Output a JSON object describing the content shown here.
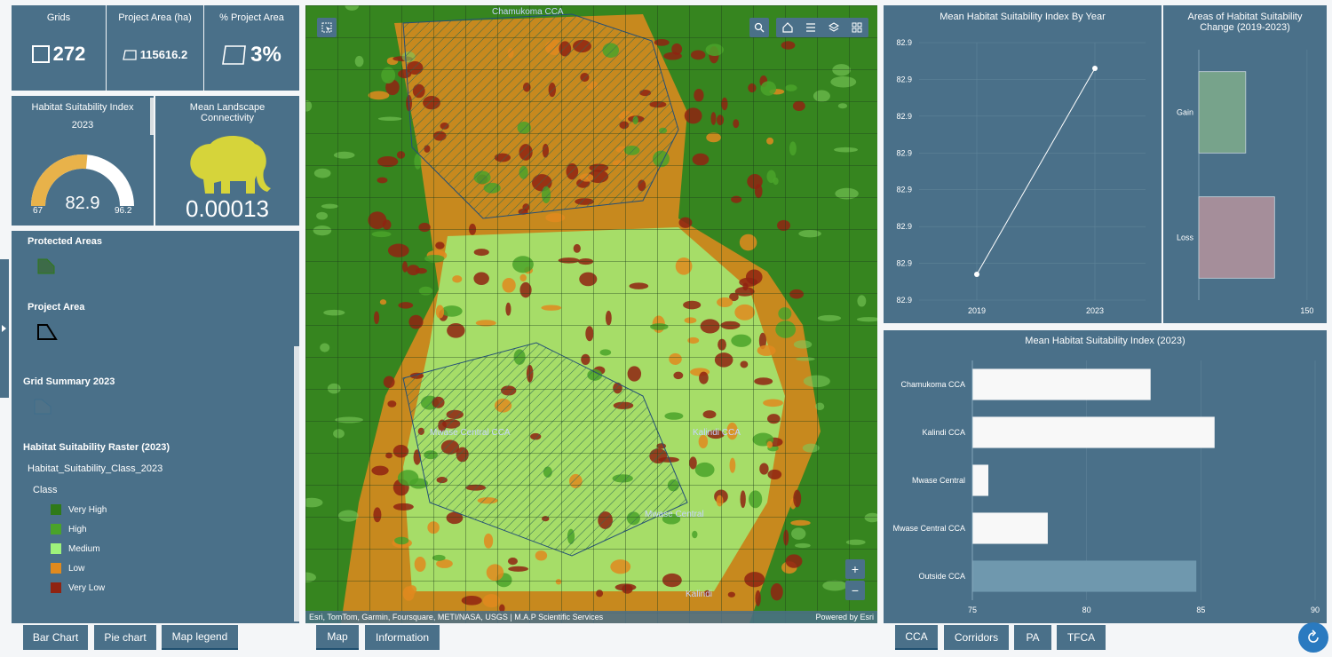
{
  "stats": {
    "grids_label": "Grids",
    "grids_value": "272",
    "area_label": "Project Area (ha)",
    "area_value": "115616.2",
    "pct_label": "% Project Area",
    "pct_value": "3%"
  },
  "hsi": {
    "title": "Habitat Suitability Index",
    "year": "2023",
    "value": "82.9",
    "min": "67",
    "max": "96.2",
    "fraction": 0.53
  },
  "connectivity": {
    "title_line1": "Mean Landscape",
    "title_line2": "Connectivity",
    "value": "0.00013"
  },
  "legend": {
    "protected": "Protected Areas",
    "project": "Project Area",
    "grid": "Grid Summary 2023",
    "raster": "Habitat Suitability Raster (2023)",
    "field": "Habitat_Suitability_Class_2023",
    "class_label": "Class",
    "classes": [
      {
        "label": "Very High",
        "color": "#2f7a19"
      },
      {
        "label": "High",
        "color": "#4aa32a"
      },
      {
        "label": "Medium",
        "color": "#9ef27b"
      },
      {
        "label": "Low",
        "color": "#e08a1e"
      },
      {
        "label": "Very Low",
        "color": "#8f2312"
      }
    ]
  },
  "map": {
    "labels": [
      "Chamukoma CCA",
      "Mwase Central CCA",
      "Kalindi CCA",
      "Mwase Central",
      "Kalindi"
    ],
    "attribution": "Esri, TomTom, Garmin, Foursquare, METI/NASA, USGS | M.A.P Scientific Services",
    "powered": "Powered by Esri",
    "icons": [
      "select-icon",
      "search-icon",
      "home-icon",
      "list-icon",
      "layers-icon",
      "grid-icon",
      "zoom-in-icon",
      "zoom-out-icon"
    ]
  },
  "tabs_left": [
    "Bar Chart",
    "Pie chart",
    "Map legend"
  ],
  "tabs_mid": [
    "Map",
    "Information"
  ],
  "tabs_right": [
    "CCA",
    "Corridors",
    "PA",
    "TFCA"
  ],
  "chart_data": [
    {
      "type": "line",
      "title": "Mean Habitat Suitability Index By Year",
      "x": [
        "2019",
        "2023"
      ],
      "series": [
        {
          "values": [
            82.86,
            82.94
          ]
        }
      ],
      "y_tick_labels": [
        "82.9",
        "82.9",
        "82.9",
        "82.9",
        "82.9",
        "82.9",
        "82.9",
        "82.9"
      ],
      "ylim": [
        82.85,
        82.95
      ]
    },
    {
      "type": "bar",
      "title_line1": "Areas of Habitat Suitability",
      "title_line2": "Change (2019-2023)",
      "categories": [
        "Gain",
        "Loss"
      ],
      "values": [
        65,
        105
      ],
      "colors": [
        "#77a38b",
        "#a58e9a"
      ],
      "x_tick_labels": [
        "150"
      ],
      "xlim": [
        0,
        160
      ]
    },
    {
      "type": "bar",
      "title": "Mean Habitat Suitability Index (2023)",
      "categories": [
        "Chamukoma CCA",
        "Kalindi CCA",
        "Mwase Central",
        "Mwase Central CCA",
        "Outside CCA"
      ],
      "values": [
        82.8,
        85.6,
        75.7,
        78.3,
        84.8
      ],
      "colors": [
        "#f8f8f8",
        "#f8f8f8",
        "#f8f8f8",
        "#f8f8f8",
        "#6f98ae"
      ],
      "x_ticks": [
        "75",
        "80",
        "85",
        "90"
      ],
      "xlim": [
        75,
        90
      ]
    }
  ]
}
